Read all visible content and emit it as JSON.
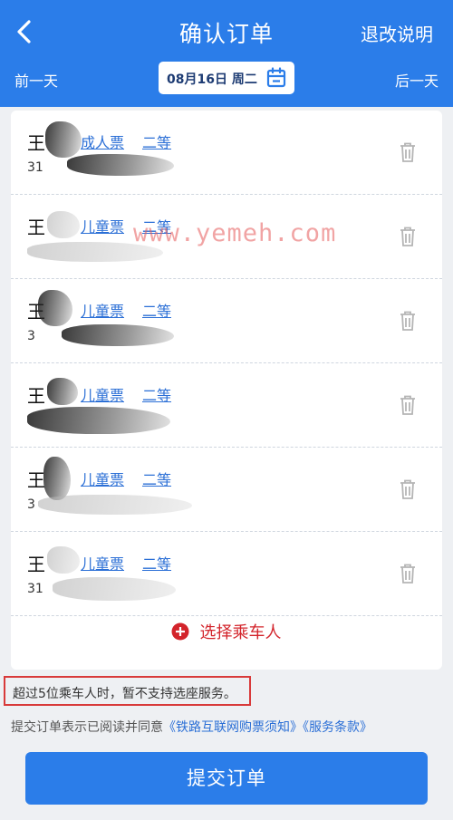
{
  "header": {
    "title": "确认订单",
    "refund_info": "退改说明",
    "prev_day": "前一天",
    "next_day": "后一天",
    "date": "08月16日 周二",
    "background_color": "#2b7de9"
  },
  "passengers": [
    {
      "name": "王",
      "ticket_type": "成人票",
      "seat_class": "二等",
      "id_visible": "31"
    },
    {
      "name": "王",
      "ticket_type": "儿童票",
      "seat_class": "二等",
      "id_visible": ""
    },
    {
      "name": "王",
      "ticket_type": "儿童票",
      "seat_class": "二等",
      "id_visible": "3"
    },
    {
      "name": "王",
      "ticket_type": "儿童票",
      "seat_class": "二等",
      "id_visible": ""
    },
    {
      "name": "王",
      "ticket_type": "儿童票",
      "seat_class": "二等",
      "id_visible": "3"
    },
    {
      "name": "王",
      "ticket_type": "儿童票",
      "seat_class": "二等",
      "id_visible": "31"
    }
  ],
  "add_passenger": "选择乘车人",
  "warning": "超过5位乘车人时，暂不支持选座服务。",
  "agreement": {
    "prefix": "提交订单表示已阅读并同意",
    "link1": "《铁路互联网购票须知》",
    "link2": "《服务条款》"
  },
  "submit": "提交订单",
  "watermark": "www.yemeh.com",
  "icons": [
    "back-arrow-icon",
    "calendar-icon",
    "trash-icon",
    "plus-icon"
  ]
}
